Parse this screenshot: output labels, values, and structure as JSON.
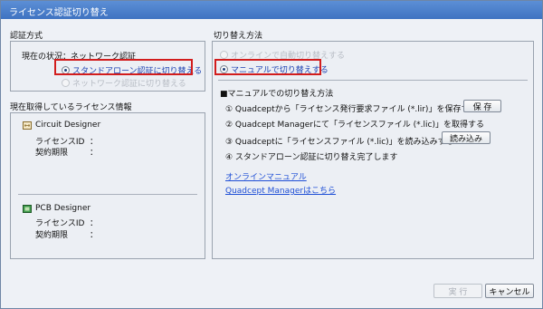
{
  "window": {
    "title": "ライセンス認証切り替え"
  },
  "auth_method": {
    "group_label": "認証方式",
    "current_status": "現在の状況：ネットワーク認証",
    "options": [
      {
        "label": "スタンドアローン認証に切り替える",
        "selected": true,
        "enabled": true
      },
      {
        "label": "ネットワーク認証に切り替える",
        "selected": false,
        "enabled": false
      }
    ]
  },
  "license_info": {
    "group_label": "現在取得しているライセンス情報",
    "products": [
      {
        "name": "Circuit Designer",
        "icon": "circuit-designer-icon",
        "fields": [
          {
            "key": "ライセンスID",
            "value": "："
          },
          {
            "key": "契約期限",
            "value": "："
          }
        ]
      },
      {
        "name": "PCB Designer",
        "icon": "pcb-designer-icon",
        "fields": [
          {
            "key": "ライセンスID",
            "value": "："
          },
          {
            "key": "契約期限",
            "value": "："
          }
        ]
      }
    ]
  },
  "switch_method": {
    "group_label": "切り替え方法",
    "options": [
      {
        "label": "オンラインで自動切り替えする",
        "selected": false,
        "enabled": false
      },
      {
        "label": "マニュアルで切り替えする",
        "selected": true,
        "enabled": true
      }
    ],
    "manual_heading": "■マニュアルでの切り替え方法",
    "steps": [
      {
        "text": "① Quadceptから「ライセンス発行要求ファイル (*.lir)」を保存する",
        "button": "保 存"
      },
      {
        "text": "② Quadcept Managerにて「ライセンスファイル (*.lic)」を取得する",
        "button": ""
      },
      {
        "text": "③ Quadceptに「ライセンスファイル (*.lic)」を読み込みする",
        "button": "読み込み"
      },
      {
        "text": "④ スタンドアローン認証に切り替え完了します",
        "button": ""
      }
    ],
    "links": [
      "オンラインマニュアル",
      "Quadcept Managerはこちら"
    ]
  },
  "footer": {
    "execute_label": "実 行",
    "cancel_label": "キャンセル"
  },
  "colors": {
    "highlight": "#d21d1d",
    "link": "#1f4fd6",
    "titlebar": "#4a7fcc"
  }
}
